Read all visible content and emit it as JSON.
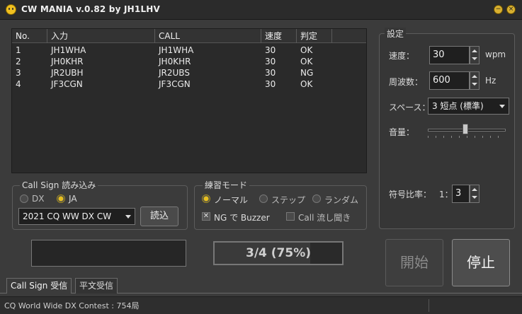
{
  "window": {
    "title": "CW MANIA v.0.82 by JH1LHV",
    "minimize_glyph": "−",
    "close_glyph": "×"
  },
  "list": {
    "columns": [
      "No.",
      "入力",
      "CALL",
      "速度",
      "判定"
    ],
    "rows": [
      {
        "no": "1",
        "input": "JH1WHA",
        "call": "JH1WHA",
        "speed": "30",
        "result": "OK"
      },
      {
        "no": "2",
        "input": "JH0KHR",
        "call": "JH0KHR",
        "speed": "30",
        "result": "OK"
      },
      {
        "no": "3",
        "input": "JR2UBH",
        "call": "JR2UBS",
        "speed": "30",
        "result": "NG"
      },
      {
        "no": "4",
        "input": "JF3CGN",
        "call": "JF3CGN",
        "speed": "30",
        "result": "OK"
      }
    ]
  },
  "callsign_group": {
    "title": "Call Sign 読み込み",
    "radio_dx": "DX",
    "radio_ja": "JA",
    "selected": "JA",
    "contest_selected": "2021 CQ WW DX CW",
    "load_button": "読込"
  },
  "mode_group": {
    "title": "練習モード",
    "normal": "ノーマル",
    "step": "ステップ",
    "random": "ランダム",
    "selected": "ノーマル",
    "ng_buzzer": "NG で Buzzer",
    "ng_buzzer_checked": true,
    "call_listen": "Call 流し聞き",
    "call_listen_checked": false
  },
  "input_field": {
    "value": ""
  },
  "progress": {
    "text": "3/4 (75%)",
    "fraction": 0.75
  },
  "settings": {
    "title": "設定",
    "speed_label": "速度：",
    "speed_value": "30",
    "speed_unit": "wpm",
    "freq_label": "周波数：",
    "freq_value": "600",
    "freq_unit": "Hz",
    "space_label": "スペース：",
    "space_value": "3 短点 (標準)",
    "volume_label": "音量：",
    "volume_level": 0.48,
    "ratio_label": "符号比率：",
    "ratio_prefix": "1：",
    "ratio_value": "3"
  },
  "buttons": {
    "start": "開始",
    "stop": "停止"
  },
  "tabs": [
    "Call Sign 受信",
    "平文受信"
  ],
  "active_tab": 0,
  "status": {
    "text": "CQ World Wide DX Contest : 754局"
  },
  "colors": {
    "accent": "#e8c020",
    "background": "#3b3b3b"
  }
}
